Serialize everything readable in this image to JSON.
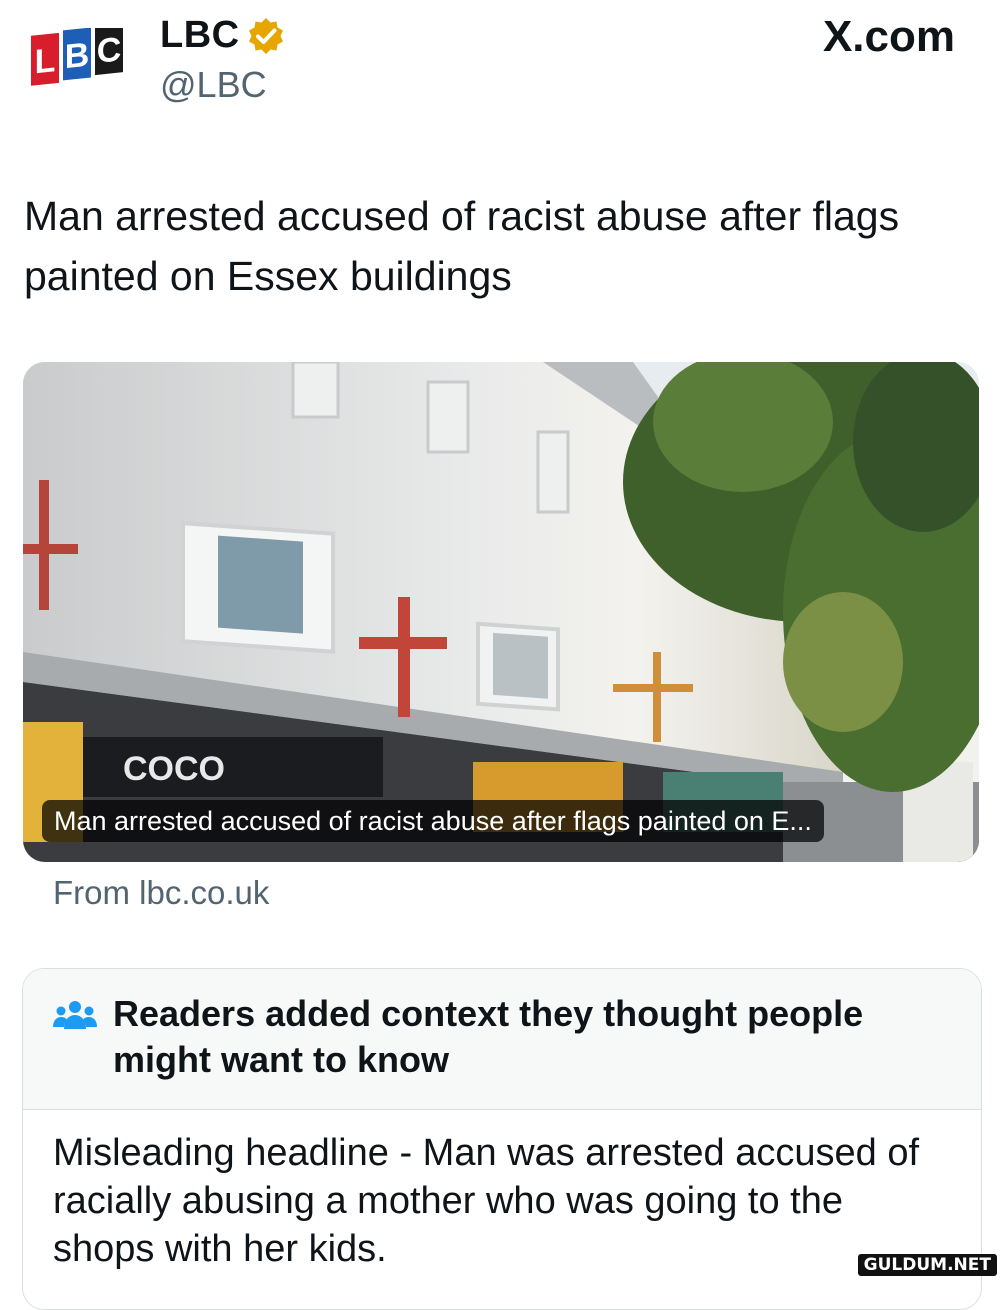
{
  "account": {
    "logo_text": "LBC",
    "display_name": "LBC",
    "handle": "@LBC",
    "verified": true
  },
  "platform": "X.com",
  "post": {
    "headline": "Man arrested accused of racist abuse after flags painted on Essex buildings",
    "media_caption": "Man arrested accused of racist abuse after flags painted on E...",
    "shop_sign": "COCO",
    "source": "From lbc.co.uk"
  },
  "community_note": {
    "title": "Readers added context they thought people might want to know",
    "body": "Misleading headline - Man was arrested accused of racially abusing a mother who was going to the shops with her kids."
  },
  "watermark": "GULDUM.NET",
  "colors": {
    "verified_gold": "#e5a600",
    "note_icon_blue": "#1d9bf0",
    "secondary_text": "#536471"
  }
}
